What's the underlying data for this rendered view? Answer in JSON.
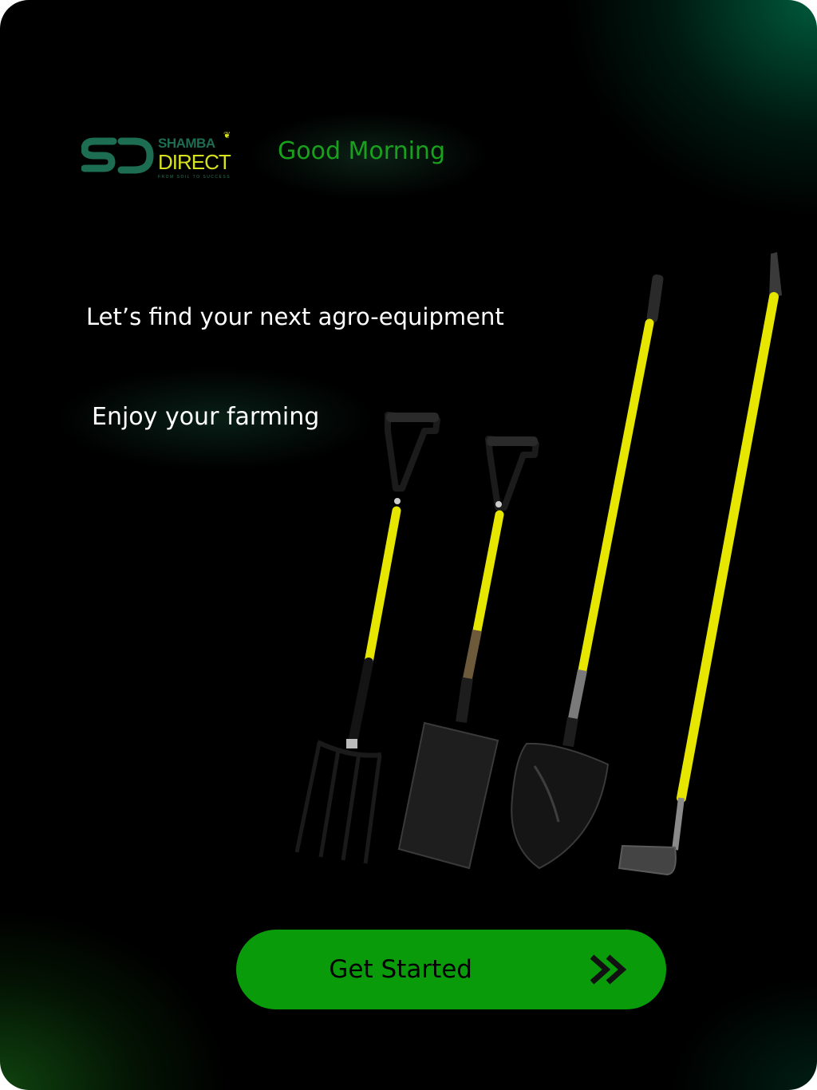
{
  "brand": {
    "logo_top": "SHAMBA",
    "logo_bottom": "DIRECT",
    "tagline": "FROM SOIL TO SUCCESS",
    "colors": {
      "green_dark": "#1d6d53",
      "lime": "#d6e21e"
    }
  },
  "greeting": "Good Morning",
  "headline": "Let’s find your next agro-equipment",
  "subline": "Enjoy your farming",
  "tools": [
    "digging-fork",
    "square-spade",
    "round-shovel",
    "garden-hoe"
  ],
  "cta": {
    "label": "Get Started",
    "icon": "double-chevron-right-icon"
  },
  "colors": {
    "background": "#000000",
    "accent": "#0a9b0a",
    "greeting": "#19a11d",
    "tool_handle": "#e6e600"
  }
}
